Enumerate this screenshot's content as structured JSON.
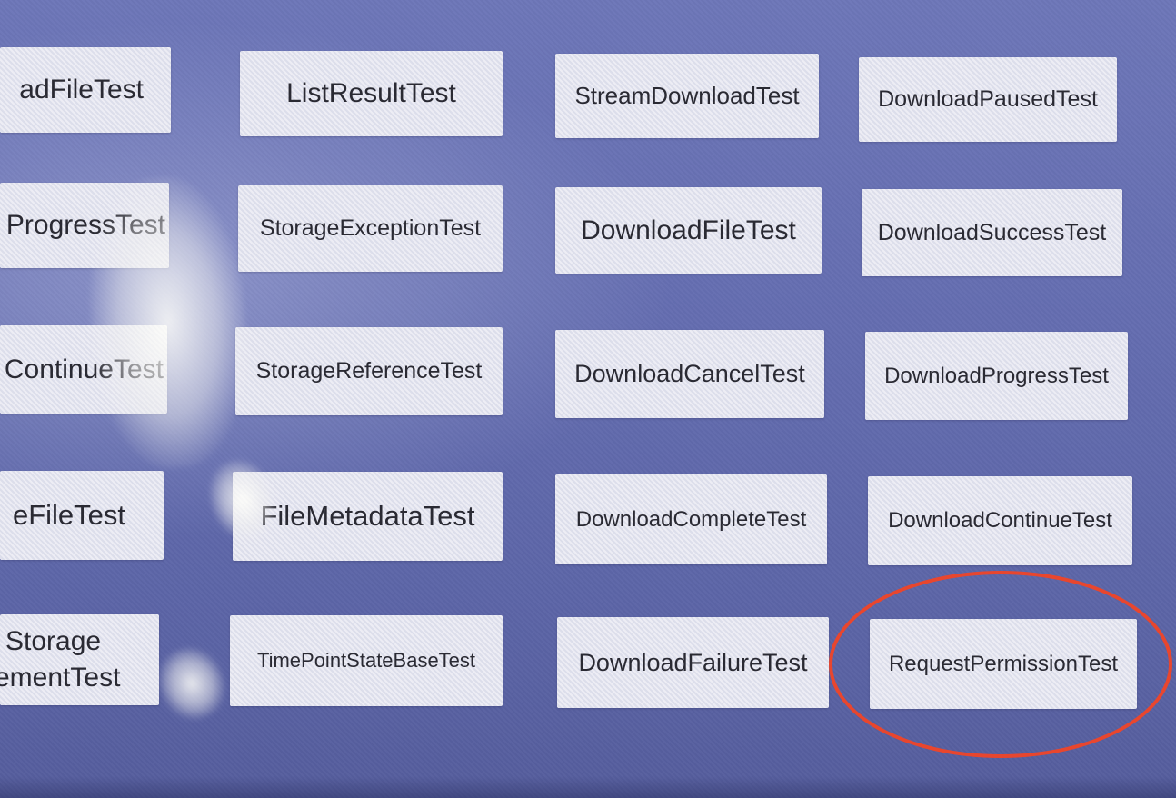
{
  "buttons": [
    {
      "id": "r0c0",
      "label": "adFileTest"
    },
    {
      "id": "r0c1",
      "label": "ListResultTest"
    },
    {
      "id": "r0c2",
      "label": "StreamDownloadTest"
    },
    {
      "id": "r0c3",
      "label": "DownloadPausedTest"
    },
    {
      "id": "r1c0",
      "label": "ProgressTest"
    },
    {
      "id": "r1c1",
      "label": "StorageExceptionTest"
    },
    {
      "id": "r1c2",
      "label": "DownloadFileTest"
    },
    {
      "id": "r1c3",
      "label": "DownloadSuccessTest"
    },
    {
      "id": "r2c0",
      "label": "ContinueTest"
    },
    {
      "id": "r2c1",
      "label": "StorageReferenceTest"
    },
    {
      "id": "r2c2",
      "label": "DownloadCancelTest"
    },
    {
      "id": "r2c3",
      "label": "DownloadProgressTest"
    },
    {
      "id": "r3c0",
      "label": "eFileTest"
    },
    {
      "id": "r3c1",
      "label": "FileMetadataTest"
    },
    {
      "id": "r3c2",
      "label": "DownloadCompleteTest"
    },
    {
      "id": "r3c3",
      "label": "DownloadContinueTest"
    },
    {
      "id": "r4c0",
      "label_line1": "Storage",
      "label_line2": "ementTest"
    },
    {
      "id": "r4c1",
      "label": "TimePointStateBaseTest"
    },
    {
      "id": "r4c2",
      "label": "DownloadFailureTest"
    },
    {
      "id": "r4c3",
      "label": "RequestPermissionTest"
    }
  ],
  "highlight": {
    "target": "RequestPermissionTest",
    "color": "#e8462e"
  },
  "colors": {
    "background": "#646db0",
    "button": "#e3e4ef",
    "text": "#2a2a33"
  }
}
